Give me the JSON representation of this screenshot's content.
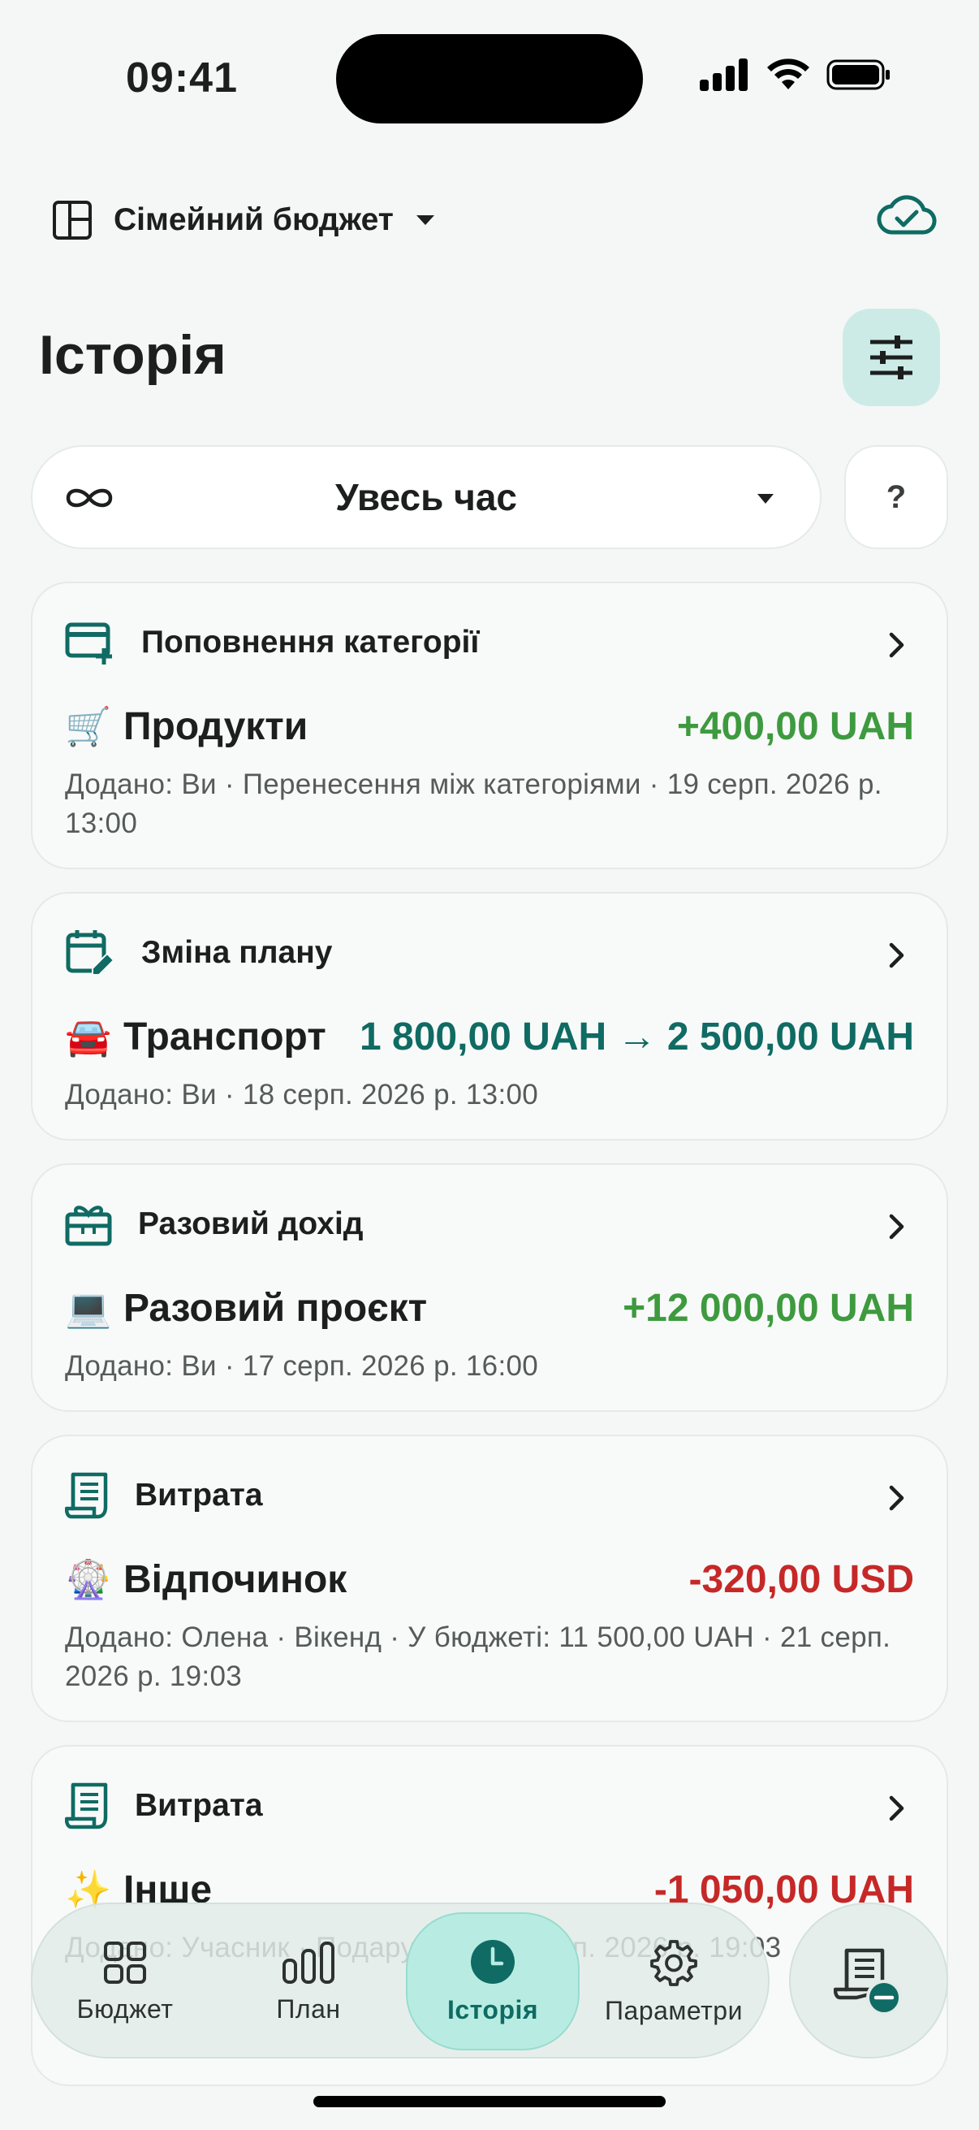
{
  "status": {
    "time": "09:41"
  },
  "header": {
    "budget_name": "Сімейний бюджет"
  },
  "page": {
    "title": "Історія"
  },
  "period": {
    "label": "Увесь час",
    "help": "?"
  },
  "entries": [
    {
      "type": "Поповнення категорії",
      "emoji": "🛒",
      "category": "Продукти",
      "amount": "+400,00 UAH",
      "meta": "Додано: Ви · Перенесення між категоріями · 19 серп. 2026 р. 13:00"
    },
    {
      "type": "Зміна плану",
      "emoji": "🚘",
      "category": "Транспорт",
      "amount": "1 800,00 UAH → 2 500,00 UAH",
      "meta": "Додано: Ви · 18 серп. 2026 р. 13:00"
    },
    {
      "type": "Разовий дохід",
      "emoji": "💻",
      "category": "Разовий проєкт",
      "amount": "+12 000,00 UAH",
      "meta": "Додано: Ви · 17 серп. 2026 р. 16:00"
    },
    {
      "type": "Витрата",
      "emoji": "🎡",
      "category": "Відпочинок",
      "amount": "-320,00 USD",
      "meta": "Додано: Олена · Вікенд · У бюджеті: 11 500,00 UAH · 21 серп. 2026 р. 19:03"
    },
    {
      "type": "Витрата",
      "emoji": "✨",
      "category": "Інше",
      "amount": "-1 050,00 UAH",
      "meta": "Додано: Учасник · Подарунок · 21 серп. 2026 р. 19:03"
    }
  ],
  "nav": [
    {
      "label": "Бюджет",
      "icon": "grid-icon"
    },
    {
      "label": "План",
      "icon": "bar-chart-icon"
    },
    {
      "label": "Історія",
      "icon": "clock-icon",
      "active": true
    },
    {
      "label": "Параметри",
      "icon": "gear-icon"
    }
  ],
  "colors": {
    "accent": "#0F6B63",
    "positive": "#3E9A3E",
    "negative": "#C62828",
    "active_tab": "#B8ECE2"
  }
}
